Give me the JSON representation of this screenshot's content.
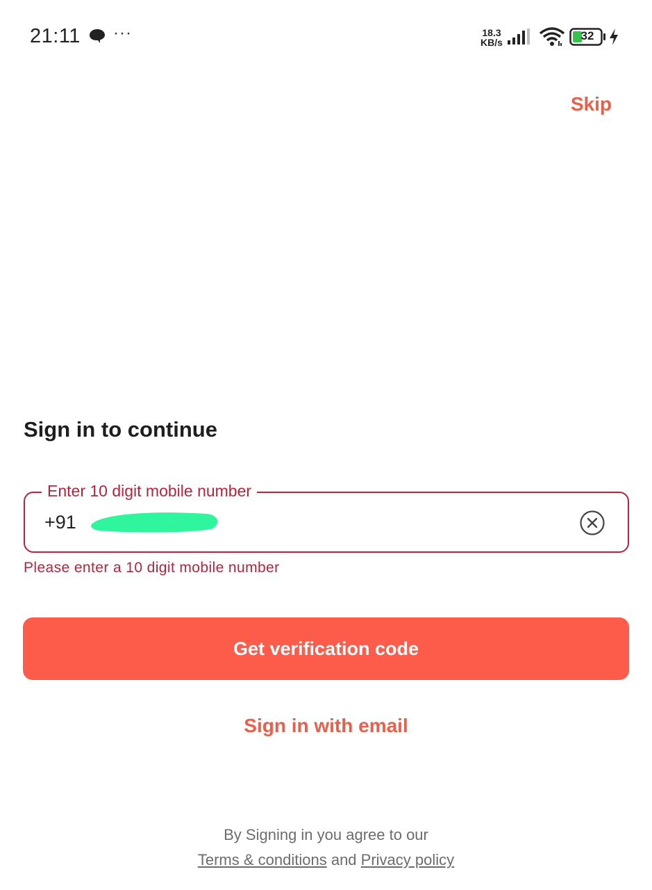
{
  "status_bar": {
    "time": "21:11",
    "more": "···",
    "net_speed_value": "18.3",
    "net_speed_unit": "KB/s",
    "battery": "32",
    "icons": [
      "chat-icon",
      "more-icon",
      "signal-icon",
      "wifi-icon",
      "battery-icon",
      "charging-icon"
    ]
  },
  "header": {
    "skip_label": "Skip"
  },
  "main": {
    "title": "Sign in to continue",
    "phone_field": {
      "legend": "Enter 10 digit mobile number",
      "country_code": "+91",
      "clear_icon": "clear-icon"
    },
    "error_message": "Please enter a 10 digit mobile number",
    "primary_button": "Get verification code",
    "email_link": "Sign in with email"
  },
  "footer": {
    "agree_text": "By Signing in you agree to our",
    "terms_label": "Terms & conditions",
    "and_text": "and",
    "privacy_label": "Privacy policy"
  },
  "colors": {
    "accent": "#fd5c4b",
    "accent_text": "#e8604c",
    "error": "#b2253c",
    "redaction": "#2ff59c"
  }
}
